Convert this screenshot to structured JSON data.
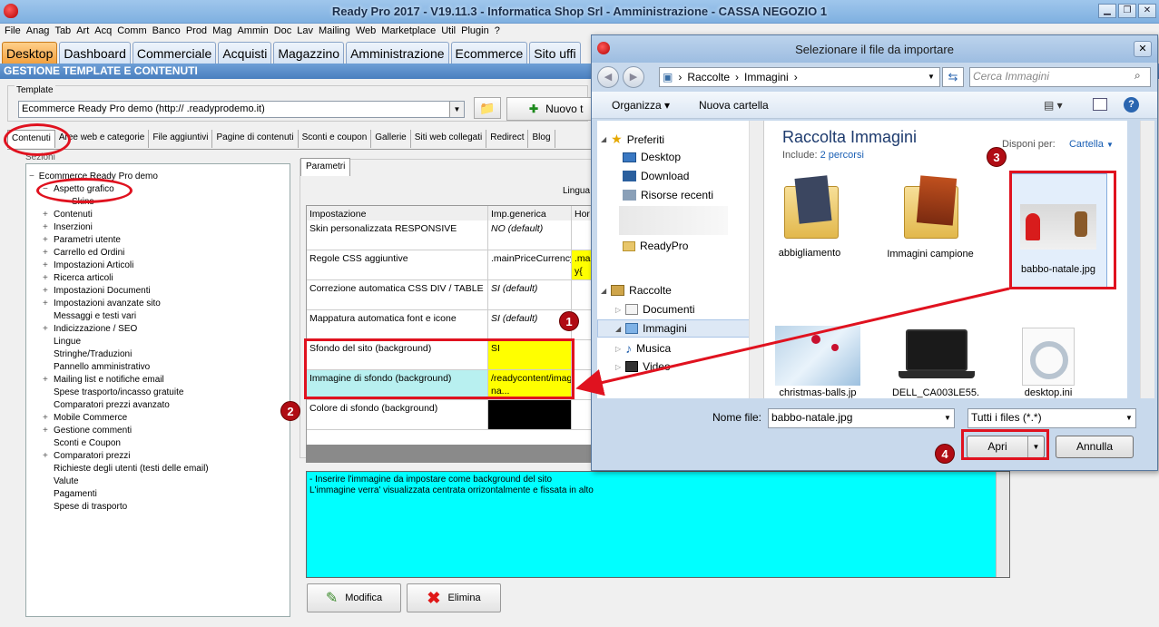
{
  "app": {
    "title": "Ready Pro 2017 - V19.11.3 - Informatica Shop Srl - Amministrazione - CASSA NEGOZIO 1",
    "menu": [
      "File",
      "Anag",
      "Tab",
      "Art",
      "Acq",
      "Comm",
      "Banco",
      "Prod",
      "Mag",
      "Ammin",
      "Doc",
      "Lav",
      "Mailing",
      "Web",
      "Marketplace",
      "Util",
      "Plugin",
      "?"
    ],
    "tabs": [
      "Desktop",
      "Dashboard",
      "Commerciale",
      "Acquisti",
      "Magazzino",
      "Amministrazione",
      "Ecommerce",
      "Sito uffi"
    ],
    "section_title": "GESTIONE TEMPLATE E CONTENUTI"
  },
  "template": {
    "label": "Template",
    "value": "Ecommerce Ready Pro demo        (http://           .readyprodemo.it)",
    "new_button": "Nuovo t"
  },
  "subtabs": [
    "Contenuti",
    "Aree web e categorie",
    "File aggiuntivi",
    "Pagine di contenuti",
    "Sconti e coupon",
    "Gallerie",
    "Siti web collegati",
    "Redirect",
    "Blog"
  ],
  "tree": {
    "header": "Sezioni",
    "root": "Ecommerce Ready Pro demo",
    "items": [
      {
        "label": "Aspetto grafico",
        "level": 1,
        "expand": "−"
      },
      {
        "label": "Skins",
        "level": 2,
        "expand": ""
      },
      {
        "label": "Contenuti",
        "level": 1,
        "expand": "+"
      },
      {
        "label": "Inserzioni",
        "level": 1,
        "expand": "+"
      },
      {
        "label": "Parametri utente",
        "level": 1,
        "expand": "+"
      },
      {
        "label": "Carrello ed Ordini",
        "level": 1,
        "expand": "+"
      },
      {
        "label": "Impostazioni Articoli",
        "level": 1,
        "expand": "+"
      },
      {
        "label": "Ricerca articoli",
        "level": 1,
        "expand": "+"
      },
      {
        "label": "Impostazioni Documenti",
        "level": 1,
        "expand": "+"
      },
      {
        "label": "Impostazioni avanzate sito",
        "level": 1,
        "expand": "+"
      },
      {
        "label": "Messaggi e testi vari",
        "level": 1,
        "expand": ""
      },
      {
        "label": "Indicizzazione / SEO",
        "level": 1,
        "expand": "+"
      },
      {
        "label": "Lingue",
        "level": 1,
        "expand": ""
      },
      {
        "label": "Stringhe/Traduzioni",
        "level": 1,
        "expand": ""
      },
      {
        "label": "Pannello amministrativo",
        "level": 1,
        "expand": ""
      },
      {
        "label": "Mailing list e notifiche email",
        "level": 1,
        "expand": "+"
      },
      {
        "label": "Spese trasporto/incasso gratuite",
        "level": 1,
        "expand": ""
      },
      {
        "label": "Comparatori prezzi avanzato",
        "level": 1,
        "expand": ""
      },
      {
        "label": "Mobile Commerce",
        "level": 1,
        "expand": "+"
      },
      {
        "label": "Gestione commenti",
        "level": 1,
        "expand": "+"
      },
      {
        "label": "Sconti e Coupon",
        "level": 1,
        "expand": ""
      },
      {
        "label": "Comparatori prezzi",
        "level": 1,
        "expand": "+"
      },
      {
        "label": "Richieste degli utenti (testi delle email)",
        "level": 1,
        "expand": ""
      },
      {
        "label": "Valute",
        "level": 1,
        "expand": ""
      },
      {
        "label": "Pagamenti",
        "level": 1,
        "expand": ""
      },
      {
        "label": "Spese di trasporto",
        "level": 1,
        "expand": ""
      }
    ]
  },
  "params": {
    "tab": "Parametri",
    "lingua_label": "Lingua",
    "headers": [
      "Impostazione",
      "Imp.generica",
      "Hor"
    ],
    "rows": [
      {
        "name": "Skin personalizzata RESPONSIVE",
        "value": "NO (default)",
        "extra": ""
      },
      {
        "name": "Regole CSS aggiuntive",
        "value": ".mainPriceCurrency{",
        "extra": ".ma y{"
      },
      {
        "name": "Correzione automatica CSS DIV / TABLE",
        "value": "SI (default)",
        "extra": ""
      },
      {
        "name": "Mappatura automatica font e icone",
        "value": "SI (default)",
        "extra": ""
      },
      {
        "name": "Sfondo del sito (background)",
        "value": "SI",
        "extra": ""
      },
      {
        "name": "Immagine di sfondo (background)",
        "value": "/readycontent/images/babbo-na...",
        "extra": ""
      },
      {
        "name": "Colore di sfondo (background)",
        "value": "",
        "extra": ""
      }
    ],
    "description": [
      "- Inserire l'immagine da impostare come background del sito",
      "L'immagine verra' visualizzata centrata orrizontalmente e fissata in alto"
    ],
    "modify_button": "Modifica",
    "delete_button": "Elimina"
  },
  "dialog": {
    "title": "Selezionare il file da importare",
    "breadcrumb": [
      "Raccolte",
      "Immagini"
    ],
    "search_placeholder": "Cerca Immagini",
    "organize": "Organizza",
    "new_folder": "Nuova cartella",
    "nav": {
      "favorites": "Preferiti",
      "fav_items": [
        "Desktop",
        "Download",
        "Risorse recenti"
      ],
      "readypro": "ReadyPro",
      "libraries": "Raccolte",
      "lib_items": [
        "Documenti",
        "Immagini",
        "Musica",
        "Video"
      ]
    },
    "library_title": "Raccolta Immagini",
    "include_label": "Include:",
    "include_value": "2 percorsi",
    "arrange_label": "Disponi per:",
    "arrange_value": "Cartella",
    "files": [
      "abbigliamento",
      "Immagini campione",
      "babbo-natale.jpg",
      "christmas-balls.jp",
      "DELL_CA003LE55.",
      "desktop.ini"
    ],
    "filename_label": "Nome file:",
    "filename_value": "babbo-natale.jpg",
    "filetype_value": "Tutti i files (*.*)",
    "open_button": "Apri",
    "cancel_button": "Annulla"
  },
  "annotations": [
    "1",
    "2",
    "3",
    "4"
  ],
  "colors": {
    "highlight_yellow": "#ffff00",
    "highlight_cyan": "#b8f0f0",
    "annotation_red": "#e0121f",
    "tab_active": "#f3a13e"
  }
}
